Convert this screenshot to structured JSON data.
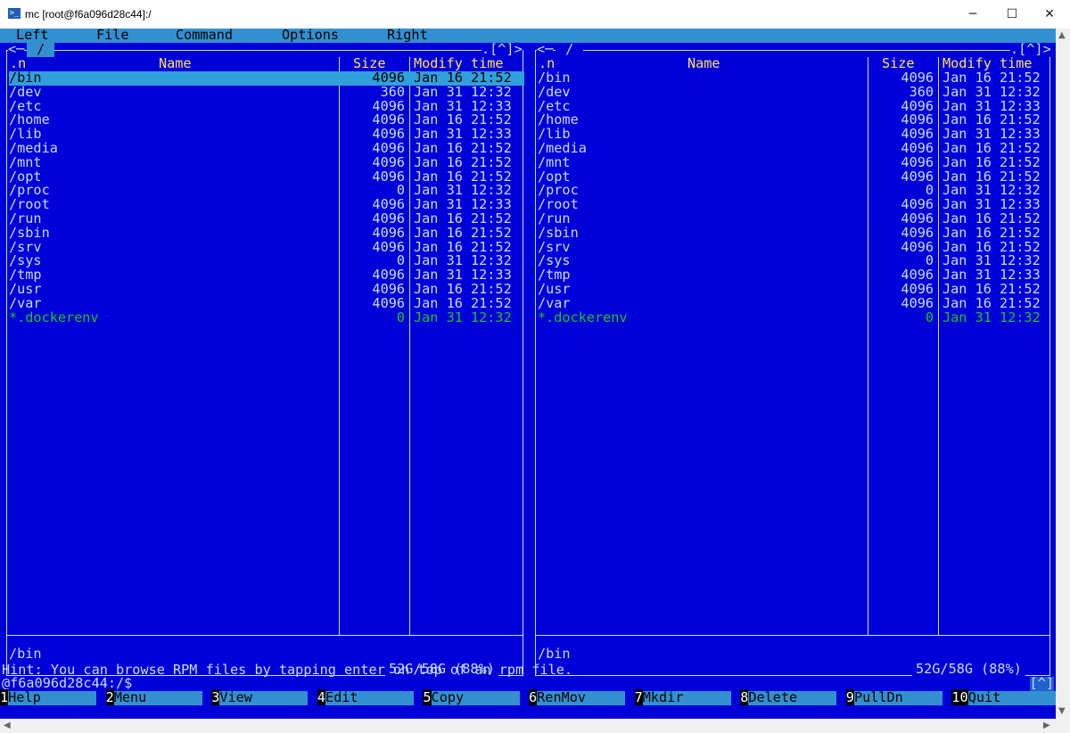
{
  "window": {
    "title": "mc [root@f6a096d28c44]:/",
    "icon": "powershell-icon",
    "minimize": "─",
    "maximize": "☐",
    "close": "✕"
  },
  "menubar": [
    "Left",
    "File",
    "Command",
    "Options",
    "Right"
  ],
  "columns": {
    "name": "Name",
    "size": "Size",
    "modify": "Modify time",
    "sort": ".n"
  },
  "panels": {
    "left": {
      "title": " / ",
      "corner": ".[^]>",
      "path": "/bin",
      "disk": "52G/58G (88%)",
      "arrow": "<─"
    },
    "right": {
      "title": " / ",
      "corner": ".[^]>",
      "path": "/bin",
      "disk": "52G/58G (88%)",
      "arrow": "<─"
    }
  },
  "entries": [
    {
      "name": "/bin",
      "size": "4096",
      "date": "Jan 16 21:52"
    },
    {
      "name": "/dev",
      "size": "360",
      "date": "Jan 31 12:32"
    },
    {
      "name": "/etc",
      "size": "4096",
      "date": "Jan 31 12:33"
    },
    {
      "name": "/home",
      "size": "4096",
      "date": "Jan 16 21:52"
    },
    {
      "name": "/lib",
      "size": "4096",
      "date": "Jan 31 12:33"
    },
    {
      "name": "/media",
      "size": "4096",
      "date": "Jan 16 21:52"
    },
    {
      "name": "/mnt",
      "size": "4096",
      "date": "Jan 16 21:52"
    },
    {
      "name": "/opt",
      "size": "4096",
      "date": "Jan 16 21:52"
    },
    {
      "name": "/proc",
      "size": "0",
      "date": "Jan 31 12:32"
    },
    {
      "name": "/root",
      "size": "4096",
      "date": "Jan 31 12:33"
    },
    {
      "name": "/run",
      "size": "4096",
      "date": "Jan 16 21:52"
    },
    {
      "name": "/sbin",
      "size": "4096",
      "date": "Jan 16 21:52"
    },
    {
      "name": "/srv",
      "size": "4096",
      "date": "Jan 16 21:52"
    },
    {
      "name": "/sys",
      "size": "0",
      "date": "Jan 31 12:32"
    },
    {
      "name": "/tmp",
      "size": "4096",
      "date": "Jan 31 12:33"
    },
    {
      "name": "/usr",
      "size": "4096",
      "date": "Jan 16 21:52"
    },
    {
      "name": "/var",
      "size": "4096",
      "date": "Jan 16 21:52"
    },
    {
      "name": "*.dockerenv",
      "size": "0",
      "date": "Jan 31 12:32",
      "green": true
    }
  ],
  "hint": "Hint: You can browse RPM files by tapping enter on top of an rpm file.",
  "prompt": "@f6a096d28c44:/$",
  "prompt_corner": "[^]",
  "fkeys": [
    {
      "num": "1",
      "label": "Help"
    },
    {
      "num": "2",
      "label": "Menu"
    },
    {
      "num": "3",
      "label": "View"
    },
    {
      "num": "4",
      "label": "Edit"
    },
    {
      "num": "5",
      "label": "Copy"
    },
    {
      "num": "6",
      "label": "RenMov"
    },
    {
      "num": "7",
      "label": "Mkdir"
    },
    {
      "num": "8",
      "label": "Delete"
    },
    {
      "num": "9",
      "label": "PullDn"
    },
    {
      "num": "10",
      "label": "Quit"
    }
  ],
  "colors": {
    "terminal_bg": "#0000d8",
    "accent": "#3390d0",
    "text": "#c9ddff",
    "header": "#ffe060",
    "exec": "#20c020"
  }
}
